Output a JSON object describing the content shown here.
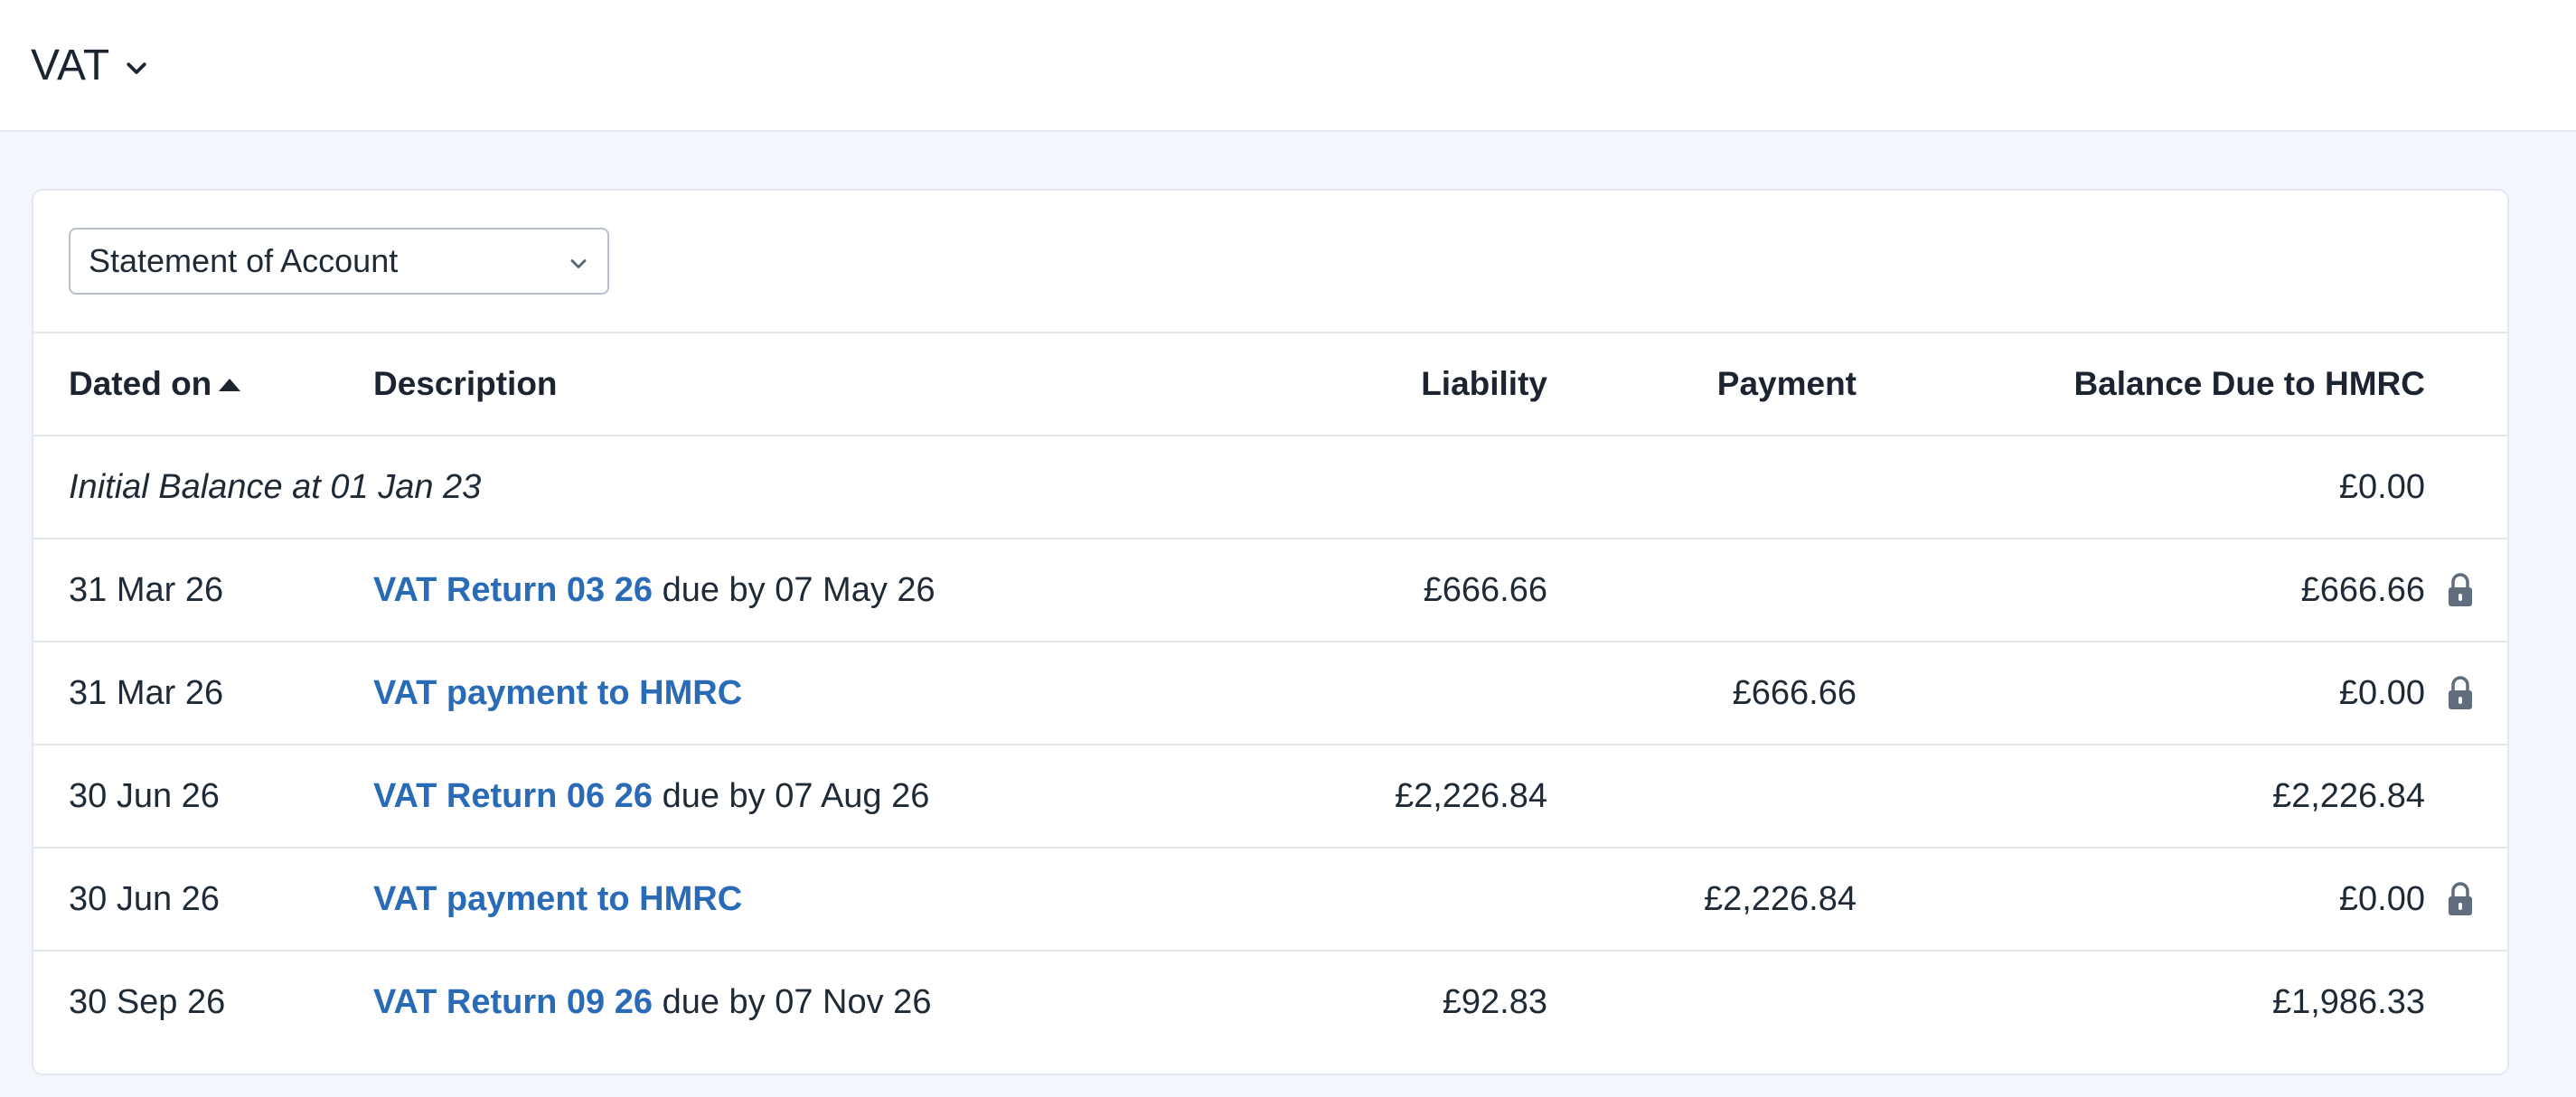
{
  "header": {
    "title": "VAT"
  },
  "filter": {
    "selected": "Statement of Account"
  },
  "table": {
    "columns": {
      "date": "Dated on",
      "description": "Description",
      "liability": "Liability",
      "payment": "Payment",
      "balance": "Balance Due to HMRC"
    },
    "initial": {
      "label": "Initial Balance at 01 Jan 23",
      "balance": "£0.00"
    },
    "rows": [
      {
        "date": "31 Mar 26",
        "link": "VAT Return 03 26",
        "suffix": " due by 07 May 26",
        "liability": "£666.66",
        "payment": "",
        "balance": "£666.66",
        "locked": true
      },
      {
        "date": "31 Mar 26",
        "link": "VAT payment to HMRC",
        "suffix": "",
        "liability": "",
        "payment": "£666.66",
        "balance": "£0.00",
        "locked": true
      },
      {
        "date": "30 Jun 26",
        "link": "VAT Return 06 26",
        "suffix": " due by 07 Aug 26",
        "liability": "£2,226.84",
        "payment": "",
        "balance": "£2,226.84",
        "locked": false
      },
      {
        "date": "30 Jun 26",
        "link": "VAT payment to HMRC",
        "suffix": "",
        "liability": "",
        "payment": "£2,226.84",
        "balance": "£0.00",
        "locked": true
      },
      {
        "date": "30 Sep 26",
        "link": "VAT Return 09 26",
        "suffix": " due by 07 Nov 26",
        "liability": "£92.83",
        "payment": "",
        "balance": "£1,986.33",
        "locked": false
      }
    ]
  },
  "icons": {
    "title_dropdown": "chevron-down-icon",
    "select_caret": "chevron-down-icon",
    "sort": "sort-ascending-icon",
    "lock": "lock-icon"
  },
  "colors": {
    "link": "#2a6bb8",
    "background": "#f3f7fd",
    "border": "#e3e8ef"
  }
}
